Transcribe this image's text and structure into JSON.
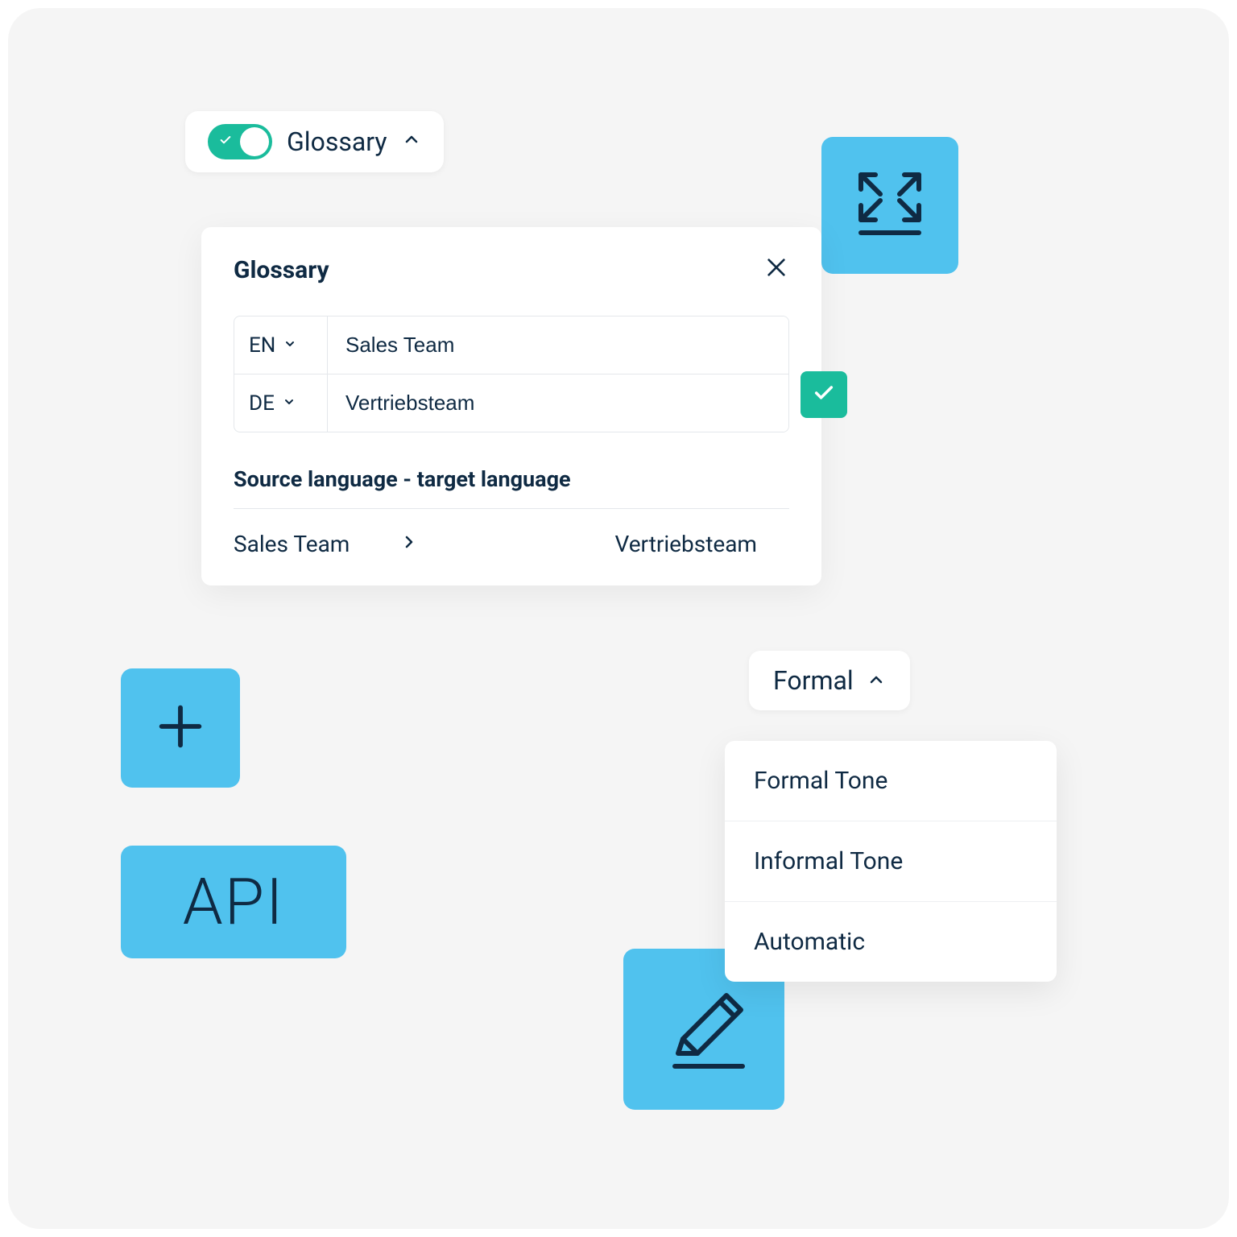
{
  "glossary_toggle": {
    "label": "Glossary",
    "enabled": true
  },
  "glossary_panel": {
    "title": "Glossary",
    "source": {
      "lang": "EN",
      "term": "Sales Team"
    },
    "target": {
      "lang": "DE",
      "term": "Vertriebsteam"
    },
    "section_label": "Source language - target language",
    "mapping": {
      "source": "Sales Team",
      "target": "Vertriebsteam"
    }
  },
  "tiles": {
    "api_label": "API"
  },
  "formality": {
    "selected": "Formal",
    "options": [
      "Formal Tone",
      "Informal Tone",
      "Automatic"
    ]
  },
  "colors": {
    "tile": "#50c2ee",
    "accent": "#1abc9c",
    "text": "#0f2a43"
  }
}
